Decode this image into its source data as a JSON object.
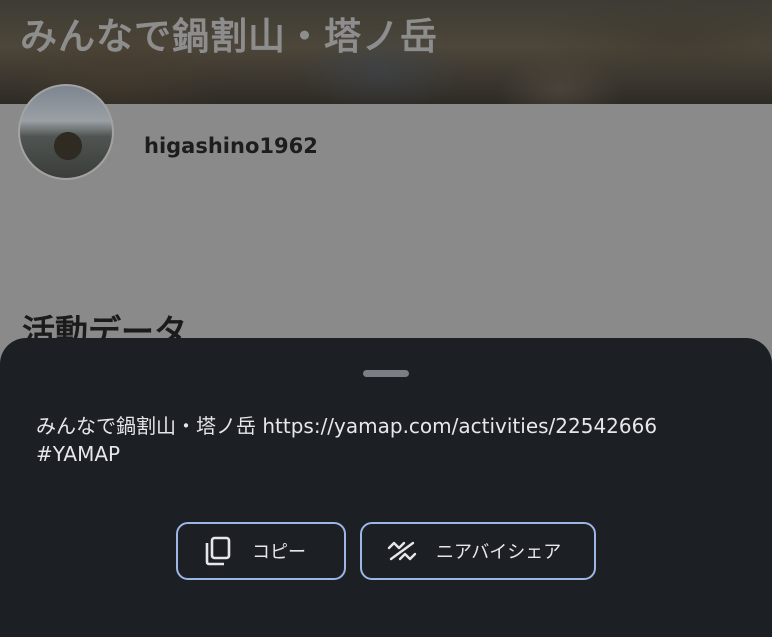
{
  "background": {
    "hero_title": "みんなで鍋割山・塔ノ岳",
    "username": "higashino1962",
    "section_title": "活動データ"
  },
  "share_sheet": {
    "line1": "みんなで鍋割山・塔ノ岳 https://yamap.com/activities/22542666",
    "line2": "#YAMAP",
    "copy_label": "コピー",
    "nearby_label": "ニアバイシェア",
    "copy_icon": "copy-icon",
    "nearby_icon": "nearby-share-icon",
    "accent_color": "#9cb6e6"
  }
}
